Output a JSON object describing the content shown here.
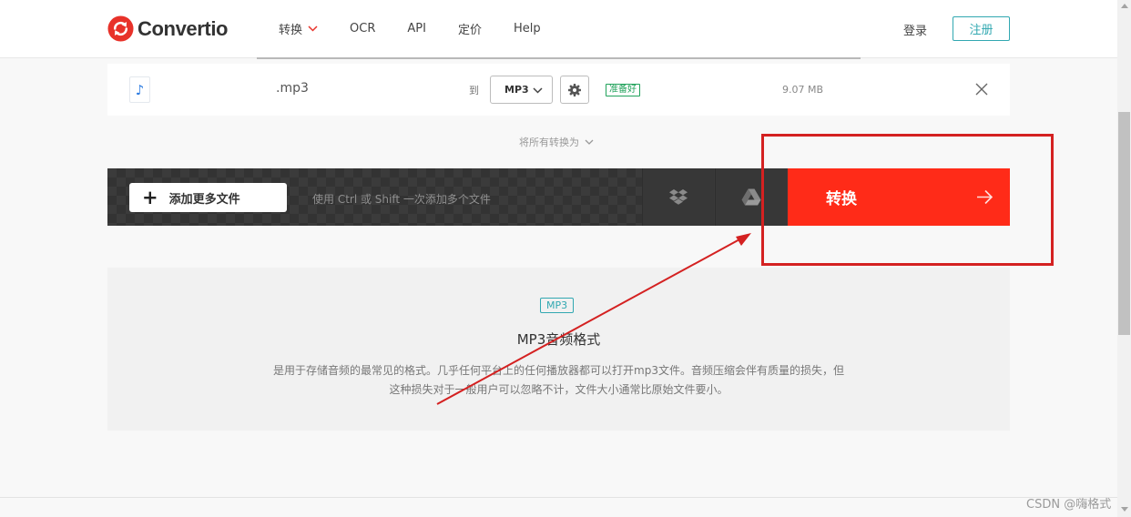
{
  "header": {
    "logo_text": "Convertio",
    "nav": [
      {
        "label": "转换",
        "has_dropdown": true
      },
      {
        "label": "OCR"
      },
      {
        "label": "API"
      },
      {
        "label": "定价"
      },
      {
        "label": "Help"
      }
    ],
    "login_label": "登录",
    "register_label": "注册"
  },
  "file_row": {
    "icon": "music-note-icon",
    "file_name": ".mp3",
    "to_label": "到",
    "selected_format": "MP3",
    "status": "准备好",
    "file_size": "9.07 MB"
  },
  "convert_all_label": "将所有转换为",
  "action_bar": {
    "add_files_label": "添加更多文件",
    "hint": "使用 Ctrl 或 Shift 一次添加多个文件",
    "cloud_icons": [
      "dropbox-icon",
      "google-drive-icon"
    ],
    "convert_label": "转换"
  },
  "info": {
    "badge": "MP3",
    "title": "MP3音频格式",
    "description": "是用于存储音频的最常见的格式。几乎任何平台上的任何播放器都可以打开mp3文件。音频压缩会伴有质量的损失，但这种损失对于一般用户可以忽略不计，文件大小通常比原始文件要小。"
  },
  "watermark": "CSDN @嗨格式",
  "colors": {
    "brand_red": "#ff2b18",
    "accent_teal": "#31a8b1",
    "ready_green": "#21a25b",
    "annotation_red": "#d42121"
  }
}
